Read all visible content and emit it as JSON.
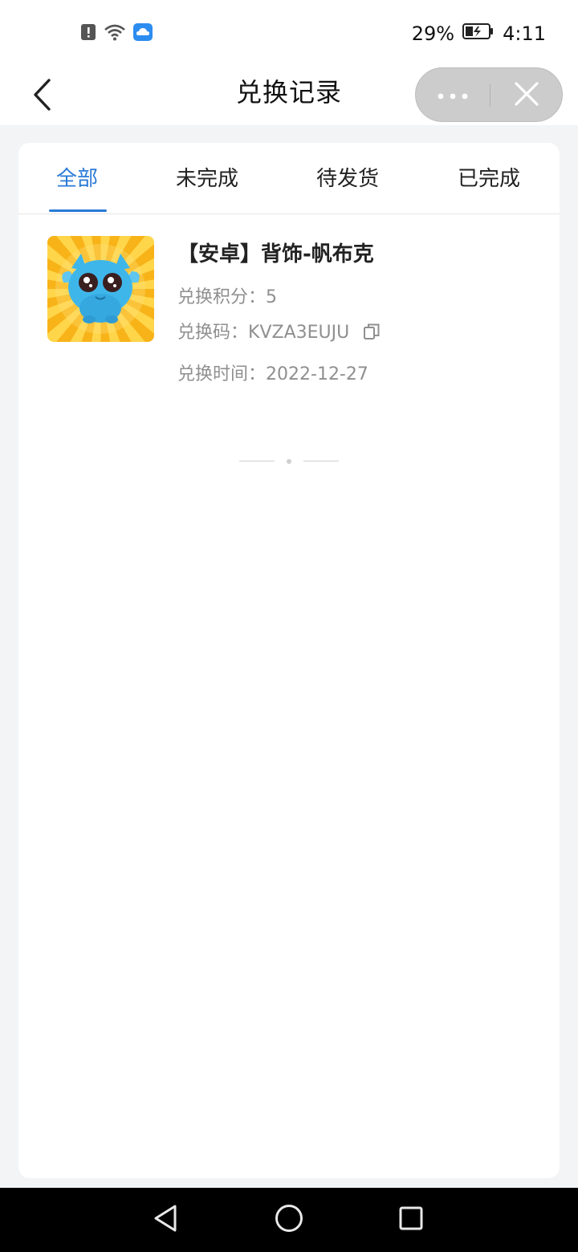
{
  "status_bar": {
    "battery_percent": "29%",
    "time": "4:11",
    "icons": [
      "alert-icon",
      "wifi-icon",
      "cloud-icon",
      "battery-charging-icon"
    ]
  },
  "nav": {
    "title": "兑换记录",
    "back_icon": "chevron-left-icon",
    "more_icon": "more-dots-icon",
    "close_icon": "close-icon"
  },
  "tabs": [
    {
      "label": "全部",
      "active": true
    },
    {
      "label": "未完成",
      "active": false
    },
    {
      "label": "待发货",
      "active": false
    },
    {
      "label": "已完成",
      "active": false
    }
  ],
  "records": [
    {
      "title": "【安卓】背饰-帆布克",
      "points_label": "兑换积分：",
      "points_value": "5",
      "code_label": "兑换码：",
      "code_value": "KVZA3EUJU",
      "time_label": "兑换时间：",
      "time_value": "2022-12-27"
    }
  ],
  "colors": {
    "accent": "#2a7ad6",
    "page_bg": "#f3f4f6",
    "secondary_text": "#8f8f8f"
  },
  "system_nav": {
    "icons": [
      "back-triangle-icon",
      "home-circle-icon",
      "recents-square-icon"
    ]
  }
}
